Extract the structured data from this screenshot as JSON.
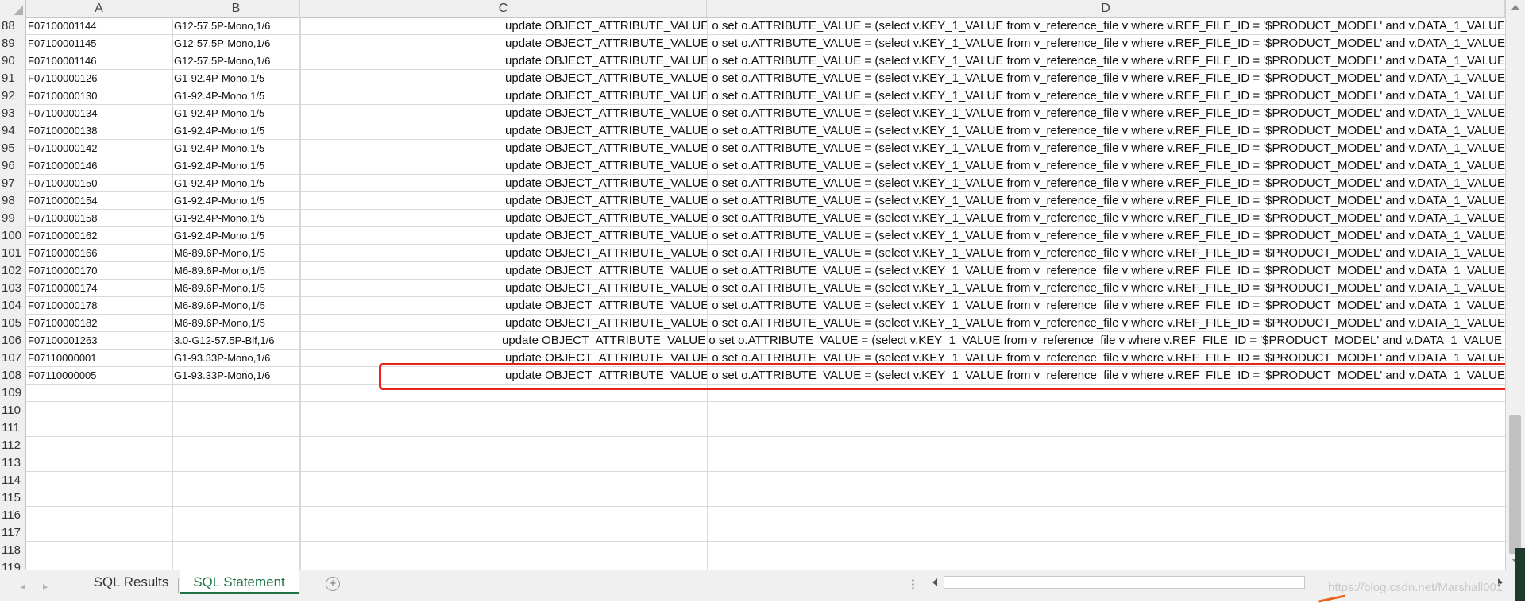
{
  "columns": [
    "A",
    "B",
    "C",
    "D"
  ],
  "rows": [
    {
      "num": "88",
      "a": "F07100001144",
      "b": "G12-57.5P-Mono,1/6",
      "sql": "update OBJECT_ATTRIBUTE_VALUE o set o.ATTRIBUTE_VALUE = (select v.KEY_1_VALUE from v_reference_file v where v.REF_FILE_ID = '$PRODUCT_MODEL' and v.DATA_1_VALUE"
    },
    {
      "num": "89",
      "a": "F07100001145",
      "b": "G12-57.5P-Mono,1/6",
      "sql": "update OBJECT_ATTRIBUTE_VALUE o set o.ATTRIBUTE_VALUE = (select v.KEY_1_VALUE from v_reference_file v where v.REF_FILE_ID = '$PRODUCT_MODEL' and v.DATA_1_VALUE"
    },
    {
      "num": "90",
      "a": "F07100001146",
      "b": "G12-57.5P-Mono,1/6",
      "sql": "update OBJECT_ATTRIBUTE_VALUE o set o.ATTRIBUTE_VALUE = (select v.KEY_1_VALUE from v_reference_file v where v.REF_FILE_ID = '$PRODUCT_MODEL' and v.DATA_1_VALUE"
    },
    {
      "num": "91",
      "a": "F07100000126",
      "b": "G1-92.4P-Mono,1/5",
      "sql": "update OBJECT_ATTRIBUTE_VALUE o set o.ATTRIBUTE_VALUE = (select v.KEY_1_VALUE from v_reference_file v where v.REF_FILE_ID = '$PRODUCT_MODEL' and v.DATA_1_VALUE"
    },
    {
      "num": "92",
      "a": "F07100000130",
      "b": "G1-92.4P-Mono,1/5",
      "sql": "update OBJECT_ATTRIBUTE_VALUE o set o.ATTRIBUTE_VALUE = (select v.KEY_1_VALUE from v_reference_file v where v.REF_FILE_ID = '$PRODUCT_MODEL' and v.DATA_1_VALUE"
    },
    {
      "num": "93",
      "a": "F07100000134",
      "b": "G1-92.4P-Mono,1/5",
      "sql": "update OBJECT_ATTRIBUTE_VALUE o set o.ATTRIBUTE_VALUE = (select v.KEY_1_VALUE from v_reference_file v where v.REF_FILE_ID = '$PRODUCT_MODEL' and v.DATA_1_VALUE"
    },
    {
      "num": "94",
      "a": "F07100000138",
      "b": "G1-92.4P-Mono,1/5",
      "sql": "update OBJECT_ATTRIBUTE_VALUE o set o.ATTRIBUTE_VALUE = (select v.KEY_1_VALUE from v_reference_file v where v.REF_FILE_ID = '$PRODUCT_MODEL' and v.DATA_1_VALUE"
    },
    {
      "num": "95",
      "a": "F07100000142",
      "b": "G1-92.4P-Mono,1/5",
      "sql": "update OBJECT_ATTRIBUTE_VALUE o set o.ATTRIBUTE_VALUE = (select v.KEY_1_VALUE from v_reference_file v where v.REF_FILE_ID = '$PRODUCT_MODEL' and v.DATA_1_VALUE"
    },
    {
      "num": "96",
      "a": "F07100000146",
      "b": "G1-92.4P-Mono,1/5",
      "sql": "update OBJECT_ATTRIBUTE_VALUE o set o.ATTRIBUTE_VALUE = (select v.KEY_1_VALUE from v_reference_file v where v.REF_FILE_ID = '$PRODUCT_MODEL' and v.DATA_1_VALUE"
    },
    {
      "num": "97",
      "a": "F07100000150",
      "b": "G1-92.4P-Mono,1/5",
      "sql": "update OBJECT_ATTRIBUTE_VALUE o set o.ATTRIBUTE_VALUE = (select v.KEY_1_VALUE from v_reference_file v where v.REF_FILE_ID = '$PRODUCT_MODEL' and v.DATA_1_VALUE"
    },
    {
      "num": "98",
      "a": "F07100000154",
      "b": "G1-92.4P-Mono,1/5",
      "sql": "update OBJECT_ATTRIBUTE_VALUE o set o.ATTRIBUTE_VALUE = (select v.KEY_1_VALUE from v_reference_file v where v.REF_FILE_ID = '$PRODUCT_MODEL' and v.DATA_1_VALUE"
    },
    {
      "num": "99",
      "a": "F07100000158",
      "b": "G1-92.4P-Mono,1/5",
      "sql": "update OBJECT_ATTRIBUTE_VALUE o set o.ATTRIBUTE_VALUE = (select v.KEY_1_VALUE from v_reference_file v where v.REF_FILE_ID = '$PRODUCT_MODEL' and v.DATA_1_VALUE"
    },
    {
      "num": "100",
      "a": "F07100000162",
      "b": "G1-92.4P-Mono,1/5",
      "sql": "update OBJECT_ATTRIBUTE_VALUE o set o.ATTRIBUTE_VALUE = (select v.KEY_1_VALUE from v_reference_file v where v.REF_FILE_ID = '$PRODUCT_MODEL' and v.DATA_1_VALUE"
    },
    {
      "num": "101",
      "a": "F07100000166",
      "b": "M6-89.6P-Mono,1/5",
      "sql": "update OBJECT_ATTRIBUTE_VALUE o set o.ATTRIBUTE_VALUE = (select v.KEY_1_VALUE from v_reference_file v where v.REF_FILE_ID = '$PRODUCT_MODEL' and v.DATA_1_VALUE"
    },
    {
      "num": "102",
      "a": "F07100000170",
      "b": "M6-89.6P-Mono,1/5",
      "sql": "update OBJECT_ATTRIBUTE_VALUE o set o.ATTRIBUTE_VALUE = (select v.KEY_1_VALUE from v_reference_file v where v.REF_FILE_ID = '$PRODUCT_MODEL' and v.DATA_1_VALUE"
    },
    {
      "num": "103",
      "a": "F07100000174",
      "b": "M6-89.6P-Mono,1/5",
      "sql": "update OBJECT_ATTRIBUTE_VALUE o set o.ATTRIBUTE_VALUE = (select v.KEY_1_VALUE from v_reference_file v where v.REF_FILE_ID = '$PRODUCT_MODEL' and v.DATA_1_VALUE"
    },
    {
      "num": "104",
      "a": "F07100000178",
      "b": "M6-89.6P-Mono,1/5",
      "sql": "update OBJECT_ATTRIBUTE_VALUE o set o.ATTRIBUTE_VALUE = (select v.KEY_1_VALUE from v_reference_file v where v.REF_FILE_ID = '$PRODUCT_MODEL' and v.DATA_1_VALUE"
    },
    {
      "num": "105",
      "a": "F07100000182",
      "b": "M6-89.6P-Mono,1/5",
      "sql": "update OBJECT_ATTRIBUTE_VALUE o set o.ATTRIBUTE_VALUE = (select v.KEY_1_VALUE from v_reference_file v where v.REF_FILE_ID = '$PRODUCT_MODEL' and v.DATA_1_VALUE"
    },
    {
      "num": "106",
      "a": "F07100001263",
      "b": "3.0-G12-57.5P-Bif,1/6",
      "sql": "update OBJECT_ATTRIBUTE_VALUE o set o.ATTRIBUTE_VALUE = (select v.KEY_1_VALUE from v_reference_file v where v.REF_FILE_ID = '$PRODUCT_MODEL' and v.DATA_1_VALUE"
    },
    {
      "num": "107",
      "a": "F07110000001",
      "b": "G1-93.33P-Mono,1/6",
      "sql": "update OBJECT_ATTRIBUTE_VALUE o set o.ATTRIBUTE_VALUE = (select v.KEY_1_VALUE from v_reference_file v where v.REF_FILE_ID = '$PRODUCT_MODEL' and v.DATA_1_VALUE"
    },
    {
      "num": "108",
      "a": "F07110000005",
      "b": "G1-93.33P-Mono,1/6",
      "sql": "update OBJECT_ATTRIBUTE_VALUE o set o.ATTRIBUTE_VALUE = (select v.KEY_1_VALUE from v_reference_file v where v.REF_FILE_ID = '$PRODUCT_MODEL' and v.DATA_1_VALUE"
    },
    {
      "num": "109",
      "a": "",
      "b": "",
      "sql": ""
    },
    {
      "num": "110",
      "a": "",
      "b": "",
      "sql": ""
    },
    {
      "num": "111",
      "a": "",
      "b": "",
      "sql": ""
    },
    {
      "num": "112",
      "a": "",
      "b": "",
      "sql": ""
    },
    {
      "num": "113",
      "a": "",
      "b": "",
      "sql": ""
    },
    {
      "num": "114",
      "a": "",
      "b": "",
      "sql": ""
    },
    {
      "num": "115",
      "a": "",
      "b": "",
      "sql": ""
    },
    {
      "num": "116",
      "a": "",
      "b": "",
      "sql": ""
    },
    {
      "num": "117",
      "a": "",
      "b": "",
      "sql": ""
    },
    {
      "num": "118",
      "a": "",
      "b": "",
      "sql": ""
    },
    {
      "num": "119",
      "a": "",
      "b": "",
      "sql": ""
    }
  ],
  "tabs": {
    "sql_results": "SQL Results",
    "sql_statement": "SQL Statement",
    "add_sheet_icon": "+"
  },
  "watermark": "https://blog.csdn.net/Marshall001",
  "colors": {
    "accent": "#217346",
    "highlight": "#e8231c"
  }
}
